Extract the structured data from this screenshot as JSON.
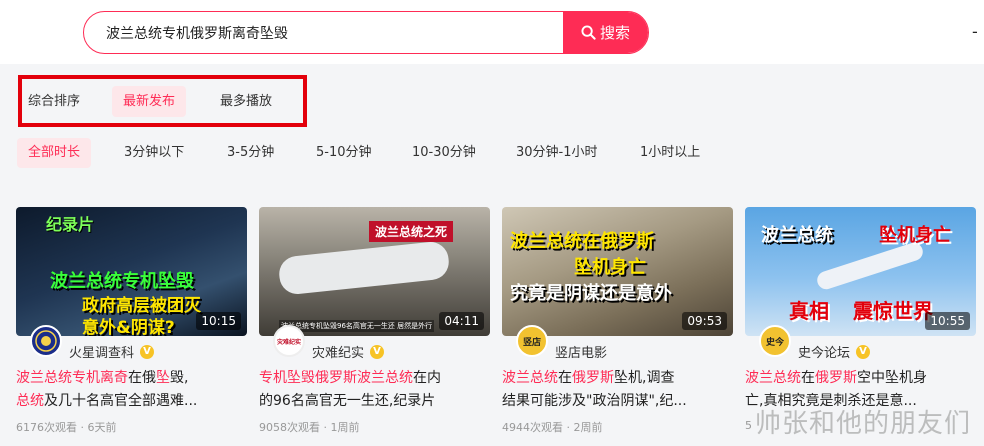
{
  "search": {
    "value": "波兰总统专机俄罗斯离奇坠毁",
    "button_label": "搜索"
  },
  "header": {
    "right_glyph": "-"
  },
  "sort_tabs": [
    {
      "label": "综合排序",
      "active": false
    },
    {
      "label": "最新发布",
      "active": true
    },
    {
      "label": "最多播放",
      "active": false
    }
  ],
  "duration_filters": [
    {
      "label": "全部时长",
      "active": true
    },
    {
      "label": "3分钟以下",
      "active": false
    },
    {
      "label": "3-5分钟",
      "active": false
    },
    {
      "label": "5-10分钟",
      "active": false
    },
    {
      "label": "10-30分钟",
      "active": false
    },
    {
      "label": "30分钟-1小时",
      "active": false
    },
    {
      "label": "1小时以上",
      "active": false
    }
  ],
  "videos": [
    {
      "duration": "10:15",
      "author": "火星调查科",
      "avatar_text": "",
      "title_lines": [
        [
          {
            "t": "波兰总统专机离奇",
            "hl": true
          },
          {
            "t": "在俄",
            "hl": false
          },
          {
            "t": "坠",
            "hl": true
          },
          {
            "t": "毁,",
            "hl": false
          }
        ],
        [
          {
            "t": "总统",
            "hl": true
          },
          {
            "t": "及几十名高官全部遇难...",
            "hl": false
          }
        ]
      ],
      "meta": "6176次观看 · 6天前",
      "thumb_text": [
        "纪录片",
        "波兰总统专机坠毁",
        "政府高层被团灭",
        "意外&阴谋?"
      ]
    },
    {
      "duration": "04:11",
      "author": "灾难纪实",
      "avatar_text": "灾难纪实",
      "title_lines": [
        [
          {
            "t": "专机坠毁俄罗斯波兰总统",
            "hl": true
          },
          {
            "t": "在内",
            "hl": false
          }
        ],
        [
          {
            "t": "的96名高官无一生还,纪录片",
            "hl": false
          }
        ]
      ],
      "meta": "9058次观看 · 1周前",
      "thumb_text": [
        "波兰总统之死",
        "波兰总统专机坠毁96名高官无一生还 居然是外行"
      ]
    },
    {
      "duration": "09:53",
      "author": "竖店电影",
      "avatar_text": "竖店",
      "title_lines": [
        [
          {
            "t": "波兰总统",
            "hl": true
          },
          {
            "t": "在",
            "hl": false
          },
          {
            "t": "俄罗斯",
            "hl": true
          },
          {
            "t": "坠机,调查",
            "hl": false
          }
        ],
        [
          {
            "t": "结果可能涉及\"政治阴谋\",纪...",
            "hl": false
          }
        ]
      ],
      "meta": "4944次观看 · 2周前",
      "thumb_text": [
        "波兰总统在俄罗斯",
        "坠机身亡",
        "究竟是阴谋还是意外"
      ]
    },
    {
      "duration": "10:55",
      "author": "史今论坛",
      "avatar_text": "史今",
      "title_lines": [
        [
          {
            "t": "波兰总统",
            "hl": true
          },
          {
            "t": "在",
            "hl": false
          },
          {
            "t": "俄罗斯",
            "hl": true
          },
          {
            "t": "空中坠机身",
            "hl": false
          }
        ],
        [
          {
            "t": "亡,真相究竟是刺杀还是意...",
            "hl": false
          }
        ]
      ],
      "meta": "5",
      "thumb_text": [
        "波兰总统",
        "坠机身亡",
        "真相",
        "震惊世界"
      ]
    }
  ],
  "watermark": "帅张和他的朋友们",
  "colors": {
    "accent": "#fe2c55",
    "highlight_box": "#e3000b",
    "verified": "#f7c325"
  }
}
